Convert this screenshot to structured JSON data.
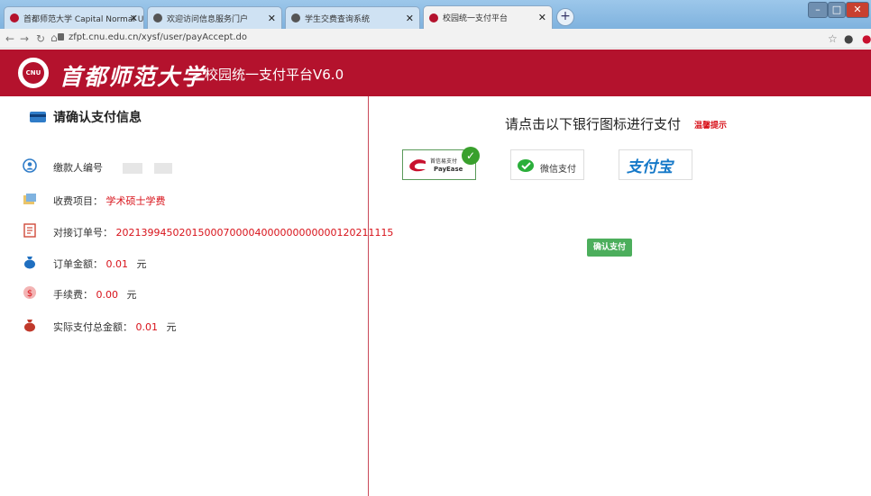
{
  "browser": {
    "tabs": [
      {
        "label": "首都师范大学 Capital Normal U",
        "active": false
      },
      {
        "label": "欢迎访问信息服务门户",
        "active": false
      },
      {
        "label": "学生交费查询系统",
        "active": false
      },
      {
        "label": "校园统一支付平台",
        "active": true
      }
    ],
    "url": "zfpt.cnu.edu.cn/xysf/user/payAccept.do"
  },
  "header": {
    "logo_text": "CNU",
    "brand": "首都师范大学",
    "subtitle": "校园统一支付平台V6.0"
  },
  "left": {
    "title": "请确认支付信息",
    "payer_label": "缴款人编号",
    "item_label": "收费项目：",
    "item_value": "学术硕士学费",
    "order_label": "对接订单号：",
    "order_value": "20213994502015000700004000000000000120211115",
    "amount_label": "订单金额：",
    "amount_value": "0.01",
    "fee_label": "手续费：",
    "fee_value": "0.00",
    "total_label": "实际支付总金额：",
    "total_value": "0.01",
    "unit": "元"
  },
  "right": {
    "title": "请点击以下银行图标进行支付",
    "tip": "温馨提示",
    "payease_cn": "首信易支付",
    "payease_en": "PayEase",
    "wechat": "微信支付",
    "alipay": "支付宝",
    "confirm": "确认支付"
  },
  "colors": {
    "brand_red": "#b4122d",
    "value_red": "#d8121a",
    "confirm_green": "#4cae5c"
  }
}
